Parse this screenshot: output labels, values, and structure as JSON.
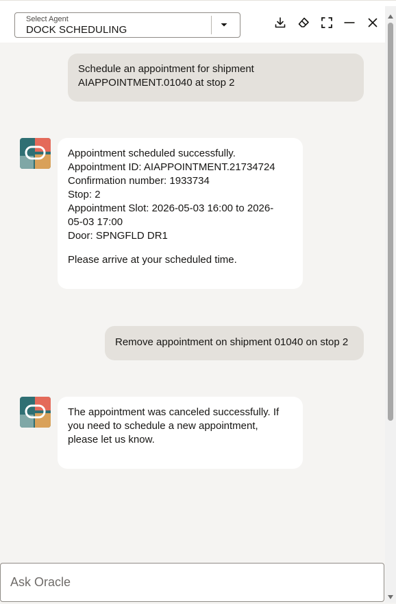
{
  "header": {
    "agent_select_label": "Select Agent",
    "agent_select_value": "DOCK SCHEDULING",
    "icons": [
      "chevron-down-icon",
      "download-icon",
      "eraser-icon",
      "expand-icon",
      "minimize-icon",
      "close-icon"
    ]
  },
  "messages": [
    {
      "role": "user",
      "lines": [
        "Schedule an appointment for shipment",
        "AIAPPOINTMENT.01040 at stop 2"
      ]
    },
    {
      "role": "assistant",
      "lines": [
        "Appointment scheduled successfully.",
        "Appointment ID: AIAPPOINTMENT.21734724",
        "Confirmation number: 1933734",
        "Stop: 2",
        "Appointment Slot: 2026-05-03 16:00 to 2026-",
        "05-03 17:00",
        "Door: SPNGFLD DR1"
      ],
      "footer": "Please arrive at your scheduled time."
    },
    {
      "role": "user",
      "lines": [
        "Remove appointment on shipment 01040 on stop 2"
      ]
    },
    {
      "role": "assistant",
      "lines": [
        "The appointment was canceled successfully. If",
        "you need to schedule a new appointment,",
        "please let us know."
      ]
    }
  ],
  "input": {
    "placeholder": "Ask Oracle",
    "value": ""
  },
  "colors": {
    "chat_bg": "#f5f4f2",
    "user_bubble": "#e4e1dc",
    "bot_bubble": "#ffffff",
    "text": "#161513"
  }
}
